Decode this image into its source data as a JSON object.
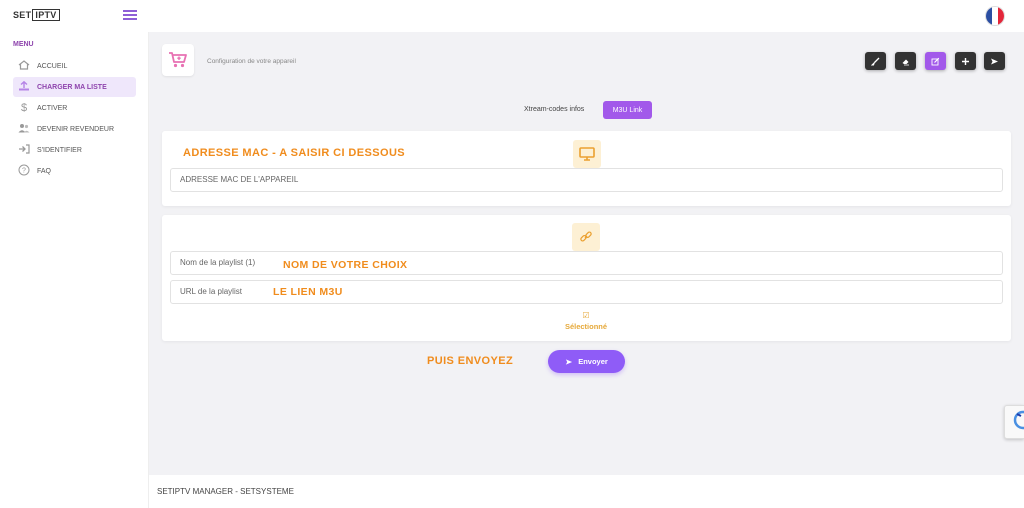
{
  "brand": {
    "part1": "SET",
    "part2": "IPTV"
  },
  "sidebar": {
    "menu_title": "MENU",
    "items": [
      {
        "label": "ACCUEIL",
        "icon": "home-icon"
      },
      {
        "label": "CHARGER MA LISTE",
        "icon": "upload-icon"
      },
      {
        "label": "ACTIVER",
        "icon": "dollar-icon"
      },
      {
        "label": "DEVENIR REVENDEUR",
        "icon": "users-icon"
      },
      {
        "label": "S'IDENTIFIER",
        "icon": "login-icon"
      },
      {
        "label": "FAQ",
        "icon": "question-icon"
      }
    ],
    "active_index": 1
  },
  "header": {
    "subtitle": "Configuration de votre appareil"
  },
  "tabs": {
    "first": "Xtream-codes infos",
    "second": "M3U Link",
    "active": "M3U Link"
  },
  "mac_card": {
    "annotation": "ADRESSE MAC - A SAISIR CI DESSOUS",
    "input_placeholder": "ADRESSE MAC DE L'APPAREIL"
  },
  "playlist_card": {
    "name_placeholder": "Nom de la playlist (1)",
    "name_annotation": "NOM DE VOTRE CHOIX",
    "url_placeholder": "URL de la playlist",
    "url_annotation": "LE LIEN M3U",
    "selected_label": "Sélectionné"
  },
  "send": {
    "annotation": "PUIS ENVOYEZ",
    "button_label": "Envoyer"
  },
  "footer": {
    "text": "SETIPTV MANAGER - SETSYSTEME"
  },
  "colors": {
    "accent": "#a259ea",
    "annotation": "#f08c1d",
    "icon_tile": "#fdf0d4"
  }
}
